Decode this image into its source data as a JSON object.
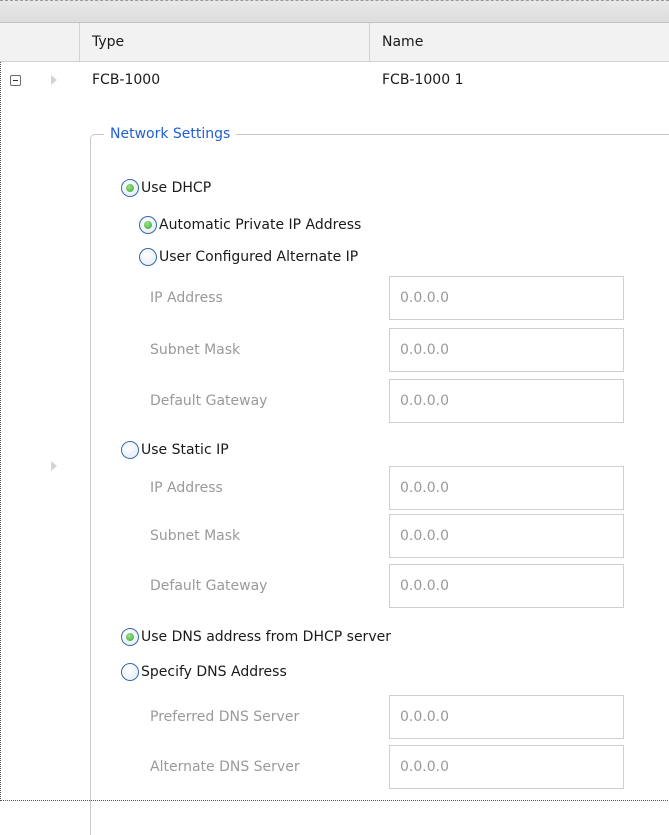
{
  "grid": {
    "columns": [
      {
        "label": "Type"
      },
      {
        "label": "Name"
      }
    ],
    "row": {
      "type": "FCB-1000",
      "name": "FCB-1000 1"
    }
  },
  "network": {
    "group_title": "Network Settings",
    "use_dhcp": {
      "label": "Use DHCP",
      "checked": true
    },
    "auto_private_ip": {
      "label": "Automatic Private IP Address",
      "checked": true
    },
    "user_configured_alt": {
      "label": "User Configured Alternate IP",
      "checked": false
    },
    "alt_fields": {
      "ip_label": "IP Address",
      "ip_value": "0.0.0.0",
      "subnet_label": "Subnet Mask",
      "subnet_value": "0.0.0.0",
      "gateway_label": "Default Gateway",
      "gateway_value": "0.0.0.0"
    },
    "use_static_ip": {
      "label": "Use Static IP",
      "checked": false
    },
    "static_fields": {
      "ip_label": "IP Address",
      "ip_value": "0.0.0.0",
      "subnet_label": "Subnet Mask",
      "subnet_value": "0.0.0.0",
      "gateway_label": "Default Gateway",
      "gateway_value": "0.0.0.0"
    },
    "use_dns_dhcp": {
      "label": "Use DNS address from DHCP server",
      "checked": true
    },
    "specify_dns": {
      "label": "Specify DNS Address",
      "checked": false
    },
    "dns_fields": {
      "preferred_label": "Preferred DNS Server",
      "preferred_value": "0.0.0.0",
      "alternate_label": "Alternate DNS Server",
      "alternate_value": "0.0.0.0"
    }
  }
}
